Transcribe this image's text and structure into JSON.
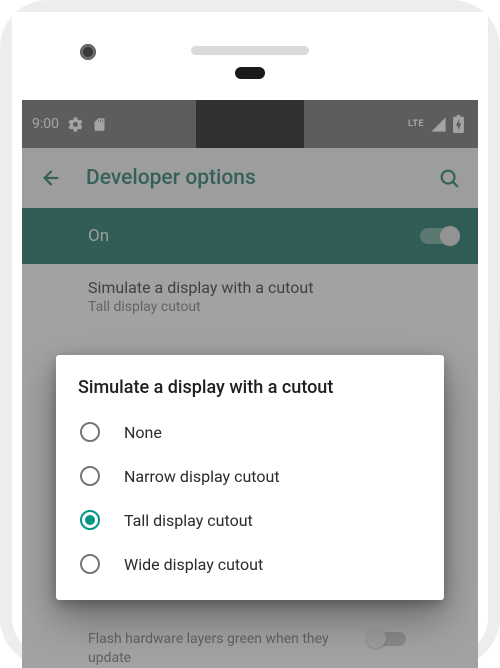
{
  "status_bar": {
    "time": "9:00",
    "icons_left": [
      "gear-icon",
      "sd-card-icon"
    ],
    "icons_right": [
      "lte-icon",
      "signal-icon",
      "battery-icon"
    ],
    "lte_label": "LTE"
  },
  "app_bar": {
    "title": "Developer options"
  },
  "master_toggle": {
    "label": "On",
    "enabled": true
  },
  "visible_setting": {
    "title": "Simulate a display with a cutout",
    "subtitle": "Tall display cutout"
  },
  "dialog": {
    "title": "Simulate a display with a cutout",
    "options": [
      {
        "label": "None",
        "selected": false
      },
      {
        "label": "Narrow display cutout",
        "selected": false
      },
      {
        "label": "Tall display cutout",
        "selected": true
      },
      {
        "label": "Wide display cutout",
        "selected": false
      }
    ]
  },
  "peek_setting": {
    "text": "Flash hardware layers green when they update"
  },
  "colors": {
    "accent": "#009688",
    "app_bar_text": "#0a6b5c",
    "toggle_bg": "#006252"
  }
}
